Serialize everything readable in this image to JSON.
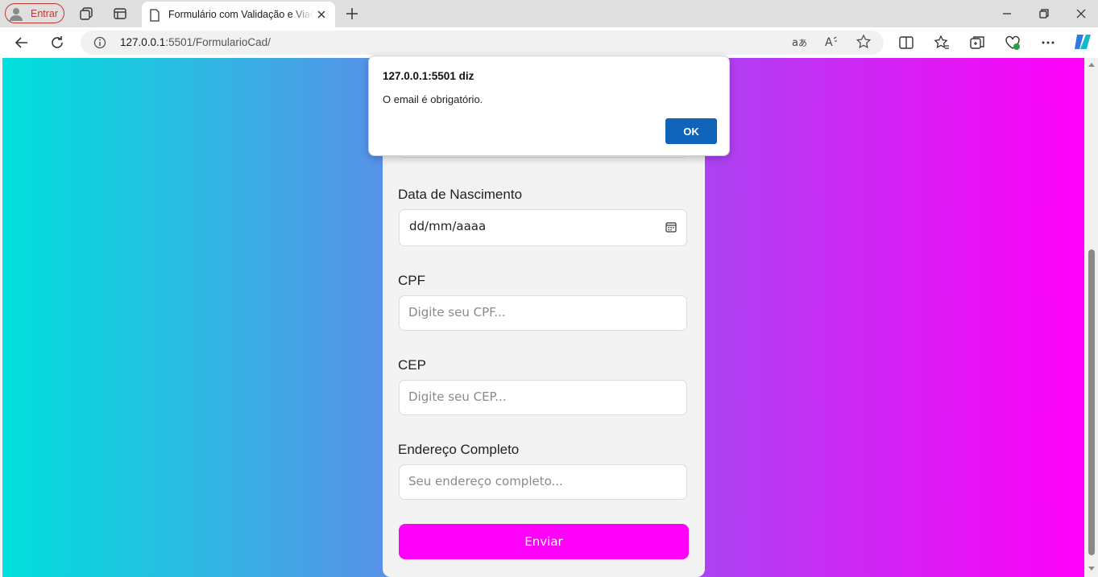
{
  "browser": {
    "profile_label": "Entrar",
    "tab_title": "Formulário com Validação e ViaCEP",
    "url_host": "127.0.0.1",
    "url_path": ":5501/FormularioCad/"
  },
  "form": {
    "birth_label": "Data de Nascimento",
    "birth_value": "dd/mm/aaaa",
    "cpf_label": "CPF",
    "cpf_placeholder": "Digite seu CPF...",
    "cep_label": "CEP",
    "cep_placeholder": "Digite seu CEP...",
    "address_label": "Endereço Completo",
    "address_placeholder": "Seu endereço completo...",
    "submit_label": "Enviar"
  },
  "dialog": {
    "title": "127.0.0.1:5501 diz",
    "message": "O email é obrigatório.",
    "ok_label": "OK"
  },
  "colors": {
    "gradient_start": "#00e0dc",
    "gradient_end": "#ff00f8",
    "submit_button": "#ff00f8",
    "dialog_ok": "#0f63b8"
  }
}
